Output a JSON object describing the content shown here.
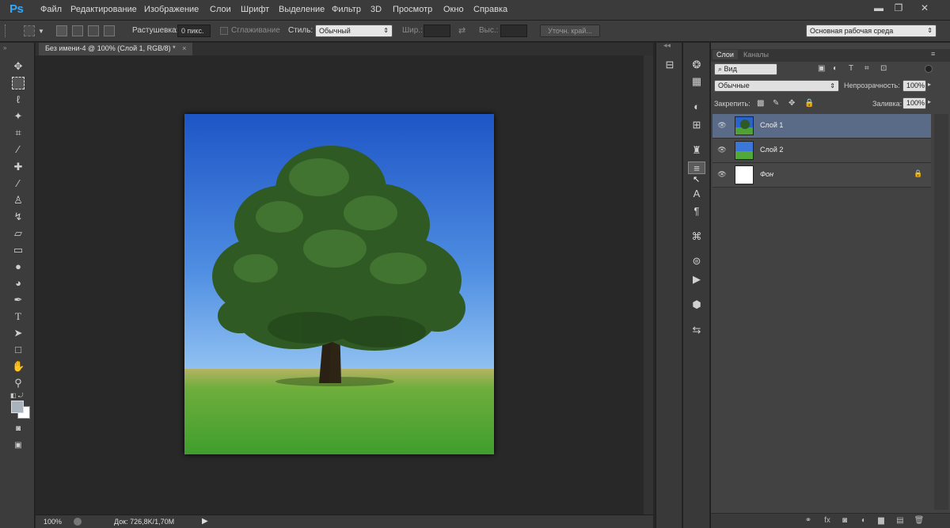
{
  "app": {
    "logo": "Ps"
  },
  "menu": [
    "Файл",
    "Редактирование",
    "Изображение",
    "Слои",
    "Шрифт",
    "Выделение",
    "Фильтр",
    "3D",
    "Просмотр",
    "Окно",
    "Справка"
  ],
  "window_controls": {
    "minimize": "▬",
    "restore": "❐",
    "close": "✕"
  },
  "options_bar": {
    "feather_label": "Растушевка:",
    "feather_value": "0 пикс.",
    "antialias_label": "Сглаживание",
    "style_label": "Стиль:",
    "style_value": "Обычный",
    "width_label": "Шир.:",
    "height_label": "Выс.:",
    "refine_button": "Уточн. край...",
    "workspace_value": "Основная рабочая среда"
  },
  "document": {
    "tab_title": "Без имени-4 @ 100% (Слой 1, RGB/8) *",
    "close_glyph": "×"
  },
  "status": {
    "zoom": "100%",
    "doc_info": "Док: 726,8K/1,70M"
  },
  "layers_panel": {
    "tabs": [
      "Слои",
      "Каналы"
    ],
    "filter_value": "Вид",
    "blend_mode": "Обычные",
    "opacity_label": "Непрозрачность:",
    "opacity_value": "100%",
    "lock_label": "Закрепить:",
    "fill_label": "Заливка:",
    "fill_value": "100%",
    "layers": [
      {
        "name": "Слой 1",
        "selected": true,
        "thumb": "tree",
        "locked": false
      },
      {
        "name": "Слой 2",
        "selected": false,
        "thumb": "sky-grass",
        "locked": false
      },
      {
        "name": "Фон",
        "selected": false,
        "thumb": "white",
        "locked": true
      }
    ],
    "bottom_icons": [
      "link-icon",
      "fx-icon",
      "mask-icon",
      "adjustment-icon",
      "folder-icon",
      "new-layer-icon",
      "trash-icon"
    ],
    "bottom_glyphs": [
      "⚭",
      "fx",
      "◙",
      "◐",
      "▆",
      "▤",
      "🗑"
    ]
  },
  "colors": {
    "selected_layer": "#5a6b87",
    "sky_top": "#1f58c8",
    "sky_bottom": "#8ec0f0",
    "grass": "#4fa935"
  }
}
